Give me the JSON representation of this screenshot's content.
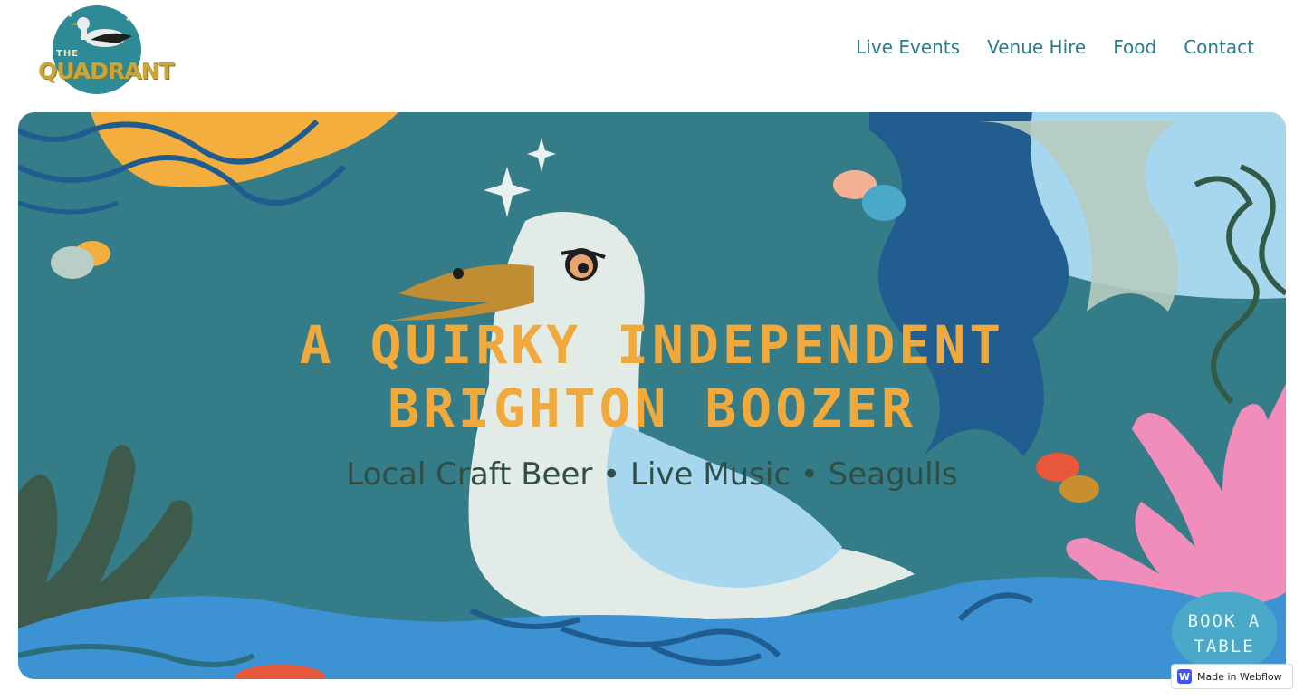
{
  "logo": {
    "line1": "THE",
    "line2": "QUADRANT",
    "icon": "seagull-logo-icon"
  },
  "nav": {
    "items": [
      {
        "label": "Live Events"
      },
      {
        "label": "Venue Hire"
      },
      {
        "label": "Food"
      },
      {
        "label": "Contact"
      }
    ]
  },
  "hero": {
    "headline_line1": "A QUIRKY INDEPENDENT",
    "headline_line2": "BRIGHTON BOOZER",
    "tagline": "Local Craft Beer • Live Music • Seagulls",
    "illustration": "seagull-in-sea-illustration"
  },
  "cta": {
    "line1": "BOOK A",
    "line2": "TABLE"
  },
  "badge": {
    "label": "Made in Webflow",
    "icon": "W"
  },
  "colors": {
    "nav_link": "#2b7d8c",
    "hero_bg": "#347d88",
    "headline": "#f2a93b",
    "tagline": "#2f4e46",
    "cta_bg": "#4aa9c9",
    "webflow_blue": "#4353ff"
  }
}
